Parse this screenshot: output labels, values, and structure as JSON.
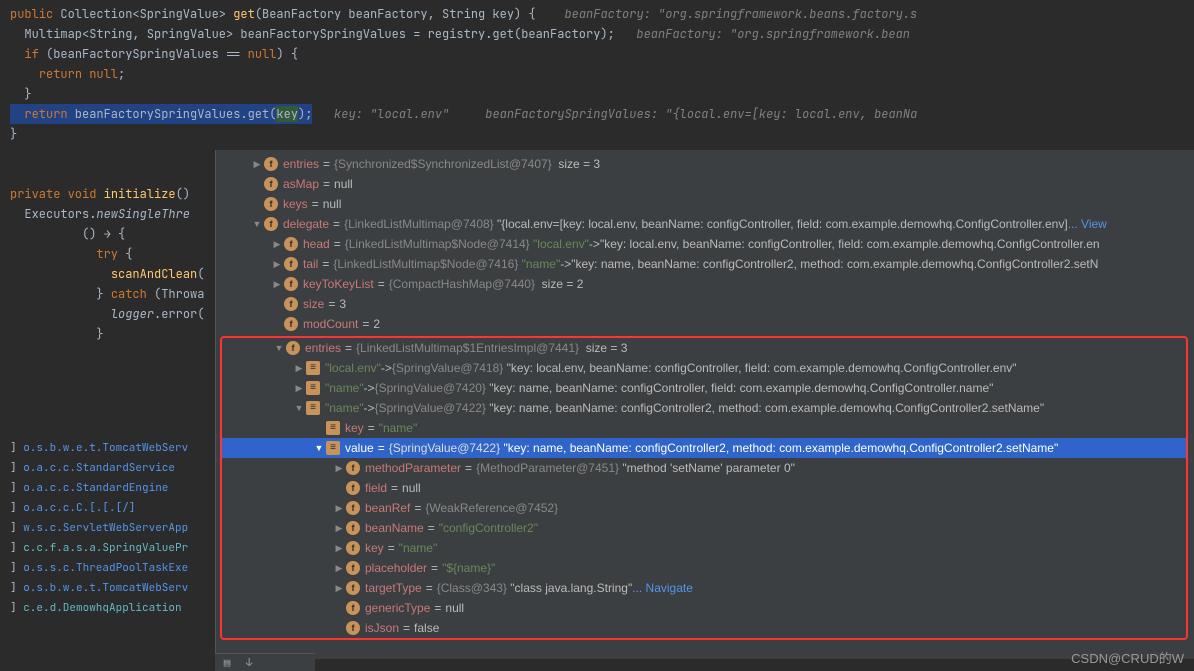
{
  "code": {
    "line1_hint": "beanFactory: \"org.springframework.beans.factory.s",
    "line2_hint": "beanFactory: \"org.springframework.bean",
    "line5_key": "key: \"local.env\"",
    "line5_bfsv": "beanFactorySpringValues: \"{local.env=[key: local.env, beanNa"
  },
  "logs": [
    {
      "cls": "o.s.b.w.e.t.TomcatWebServ"
    },
    {
      "cls": "o.a.c.c.StandardService"
    },
    {
      "cls": "o.a.c.c.StandardEngine"
    },
    {
      "cls": "o.a.c.c.C.[.[.[/]"
    },
    {
      "cls": "w.s.c.ServletWebServerApp"
    },
    {
      "cls": "c.c.f.a.s.a.SpringValuePr"
    },
    {
      "cls": "o.s.s.c.ThreadPoolTaskExe"
    },
    {
      "cls": "o.s.b.w.e.t.TomcatWebServ"
    },
    {
      "cls": "c.e.d.DemowhqApplication"
    }
  ],
  "tree": {
    "entries1": {
      "name": "entries",
      "type": "{Synchronized$SynchronizedList@7407}",
      "size": "size = 3"
    },
    "asMap": {
      "name": "asMap",
      "val": "null"
    },
    "keys": {
      "name": "keys",
      "val": "null"
    },
    "delegate": {
      "name": "delegate",
      "type": "{LinkedListMultimap@7408}",
      "val": "\"{local.env=[key: local.env, beanName: configController, field: com.example.demowhq.ConfigController.env]",
      "view": "... View"
    },
    "head": {
      "name": "head",
      "type": "{LinkedListMultimap$Node@7414}",
      "key": "\"local.env\"",
      "val": "\"key: local.env, beanName: configController, field: com.example.demowhq.ConfigController.en"
    },
    "tail": {
      "name": "tail",
      "type": "{LinkedListMultimap$Node@7416}",
      "key": "\"name\"",
      "val": "\"key: name, beanName: configController2, method: com.example.demowhq.ConfigController2.setN"
    },
    "keyToKeyList": {
      "name": "keyToKeyList",
      "type": "{CompactHashMap@7440}",
      "size": "size = 2"
    },
    "size": {
      "name": "size",
      "val": "3"
    },
    "modCount": {
      "name": "modCount",
      "val": "2"
    },
    "entries2": {
      "name": "entries",
      "type": "{LinkedListMultimap$1EntriesImpl@7441}",
      "size": "size = 3"
    },
    "e2_0": {
      "key": "\"local.env\"",
      "type": "{SpringValue@7418}",
      "val": "\"key: local.env, beanName: configController, field: com.example.demowhq.ConfigController.env\""
    },
    "e2_1": {
      "key": "\"name\"",
      "type": "{SpringValue@7420}",
      "val": "\"key: name, beanName: configController, field: com.example.demowhq.ConfigController.name\""
    },
    "e2_2": {
      "key": "\"name\"",
      "type": "{SpringValue@7422}",
      "val": "\"key: name, beanName: configController2, method: com.example.demowhq.ConfigController2.setName\""
    },
    "e2_2_key": {
      "name": "key",
      "val": "\"name\""
    },
    "e2_2_value": {
      "name": "value",
      "type": "{SpringValue@7422}",
      "val": "\"key: name, beanName: configController2, method: com.example.demowhq.ConfigController2.setName\""
    },
    "methodParameter": {
      "name": "methodParameter",
      "type": "{MethodParameter@7451}",
      "val": "\"method 'setName' parameter 0\""
    },
    "field": {
      "name": "field",
      "val": "null"
    },
    "beanRef": {
      "name": "beanRef",
      "type": "{WeakReference@7452}"
    },
    "beanName": {
      "name": "beanName",
      "val": "\"configController2\""
    },
    "key2": {
      "name": "key",
      "val": "\"name\""
    },
    "placeholder": {
      "name": "placeholder",
      "val": "\"${name}\""
    },
    "targetType": {
      "name": "targetType",
      "type": "{Class@343}",
      "val": "\"class java.lang.String\"",
      "nav": "... Navigate"
    },
    "genericType": {
      "name": "genericType",
      "val": "null"
    },
    "isJson": {
      "name": "isJson",
      "val": "false"
    }
  },
  "watermark": "CSDN@CRUD的W"
}
